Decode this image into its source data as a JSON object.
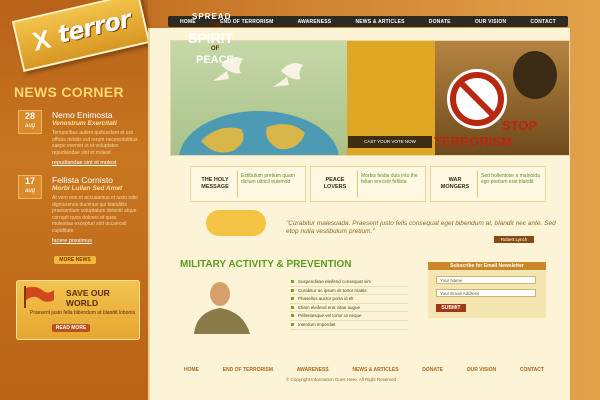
{
  "logo": {
    "text": "terror",
    "mark": "X"
  },
  "nav": [
    "HOME",
    "END OF TERRORISM",
    "AWARENESS",
    "NEWS & ARTICLES",
    "DONATE",
    "OUR VISION",
    "CONTACT"
  ],
  "news_corner": {
    "title": "NEWS CORNER",
    "items": [
      {
        "day": "28",
        "month": "aug",
        "headline": "Nemo Enimosta",
        "subhead": "Venostrum Exercitati",
        "body": "Temporibus autem quibusdam et aut officiis debitis aut rerum necessitatibus saepe eveniet ut et voluptates repudiandae sint et molest",
        "link": "repudiandae sint et molest"
      },
      {
        "day": "17",
        "month": "aug",
        "headline": "Fellista Cornisto",
        "subhead": "Morbi Lullan Sed Amet",
        "body": "At vero eos et accusamus et iusto odio dignissimos ducimus qui blanditiis praesentium voluptatum deleniti atque corrupti quos dolores et quas molestias excepturi sint occaecati cupiditate",
        "link": "facere possimus"
      }
    ],
    "more_label": "MORE NEWS"
  },
  "save_world": {
    "title": "SAVE OUR WORLD",
    "body": "Praesent justo fella bibendum at blandit lobortis",
    "button": "READ MORE"
  },
  "banner": {
    "line1": "SPREAD",
    "line2": "THE",
    "line3": "SPIRIT",
    "line4": "OF",
    "line5": "PEACE",
    "vote": "CAST YOUR VOTE NOW",
    "stop": "STOP",
    "terrorism": "TERRORISM"
  },
  "boxes": [
    {
      "head": "THE HOLY MESSAGE",
      "body": "Estibulum pretium quam dictum ultricil euismod"
    },
    {
      "head": "PEACE LOVERS",
      "body": "Morbis festia duis into the fellan erecsor fellista"
    },
    {
      "head": "WAR MONGERS",
      "body": "Sed hollentose a malnoida ego pretium erat blandit"
    }
  ],
  "quote": {
    "text": "\"Curabitur malesuada. Praesent justo fells consequat eget bibendum at, blandit nec ante. Sed etop nulla vestibulum pretium.\"",
    "author": "Robert Lynch"
  },
  "military": {
    "title": "MILITARY ACTIVITY & PREVENTION",
    "items": [
      "Suspendisse eleifend consequat vim",
      "Curabitur ac ipsum sit tortor mattis",
      "Phasellus auctor porta id elt",
      "Etiam eleifend erat vitae augue",
      "Pellentesque vel tortor ut neque",
      "Interdum imperdiet"
    ]
  },
  "newsletter": {
    "title": "Subscribe for Email Newsletter",
    "name_placeholder": "Your Name",
    "email_placeholder": "Your Email Address",
    "submit": "SUBMIT"
  },
  "footer": {
    "links": [
      "HOME",
      "END OF TERRORISM",
      "AWARENESS",
      "NEWS & ARTICLES",
      "DONATE",
      "OUR VISION",
      "CONTACT"
    ],
    "copyright": "© Copyright Information Goes Here. All Right Reserved"
  }
}
